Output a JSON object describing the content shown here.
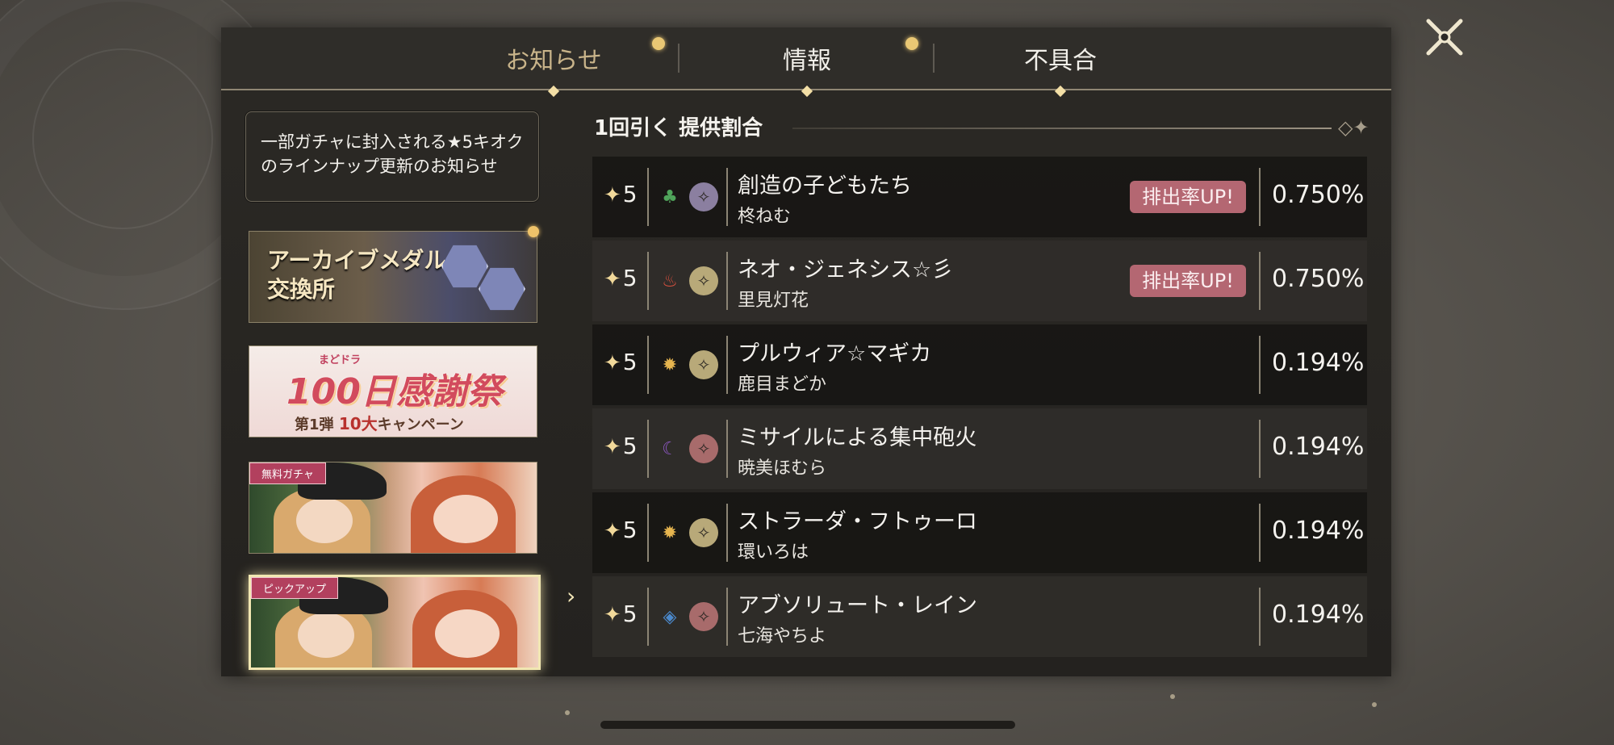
{
  "tabs": [
    {
      "label": "お知らせ",
      "active": true
    },
    {
      "label": "情報",
      "active": false
    },
    {
      "label": "不具合",
      "active": false
    }
  ],
  "sidebar": {
    "notice_text": "一部ガチャに封入される★5キオクのラインナップ更新のお知らせ",
    "banners": [
      {
        "name": "archive-medal",
        "lines": [
          "アーカイブメダル",
          "交換所"
        ]
      },
      {
        "name": "thanks-festival",
        "small": "まどドラ",
        "big": "100日感謝祭",
        "sub_prefix": "第1弾",
        "sub_strong": "10大",
        "sub_suffix": "キャンペーン"
      },
      {
        "name": "free-gacha",
        "tag": "無料ガチャ"
      },
      {
        "name": "pickup",
        "tag": "ピックアップ"
      }
    ]
  },
  "content": {
    "title": "1回引く 提供割合",
    "rows": [
      {
        "rarity": "5",
        "name": "創造の子どもたち",
        "character": "柊ねむ",
        "up_label": "排出率UP!",
        "rate": "0.750%",
        "attribute": "leaf",
        "attr_color": "#4fa35a",
        "type_color": "#8b7fa0"
      },
      {
        "rarity": "5",
        "name": "ネオ・ジェネシス☆彡",
        "character": "里見灯花",
        "up_label": "排出率UP!",
        "rate": "0.750%",
        "attribute": "flame",
        "attr_color": "#d9503e",
        "type_color": "#b8a979"
      },
      {
        "rarity": "5",
        "name": "プルウィア☆マギカ",
        "character": "鹿目まどか",
        "up_label": "",
        "rate": "0.194%",
        "attribute": "sun",
        "attr_color": "#e6b54f",
        "type_color": "#b8a979"
      },
      {
        "rarity": "5",
        "name": "ミサイルによる集中砲火",
        "character": "暁美ほむら",
        "up_label": "",
        "rate": "0.194%",
        "attribute": "moon",
        "attr_color": "#8e58c4",
        "type_color": "#a86b6b"
      },
      {
        "rarity": "5",
        "name": "ストラーダ・フトゥーロ",
        "character": "環いろは",
        "up_label": "",
        "rate": "0.194%",
        "attribute": "sun",
        "attr_color": "#e6b54f",
        "type_color": "#b8a979"
      },
      {
        "rarity": "5",
        "name": "アブソリュート・レイン",
        "character": "七海やちよ",
        "up_label": "",
        "rate": "0.194%",
        "attribute": "water",
        "attr_color": "#4b89cc",
        "type_color": "#a86b6b"
      }
    ]
  }
}
